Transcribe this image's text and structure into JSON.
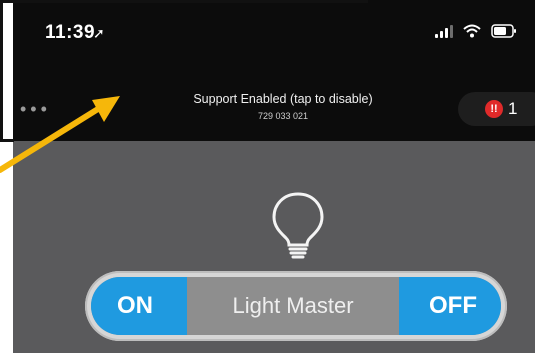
{
  "status_bar": {
    "time": "11:39",
    "location_icon": "location-arrow-icon",
    "signal_icon": "cellular-signal-icon",
    "wifi_icon": "wifi-icon",
    "battery_icon": "battery-icon"
  },
  "support_bar": {
    "menu_icon": "more-dots-icon",
    "message": "Support Enabled (tap to disable)",
    "support_id": "729 033 021",
    "alert_icon": "alert-icon",
    "alert_count": "1"
  },
  "device": {
    "icon": "light-bulb-icon",
    "name": "Light Master",
    "on_label": "ON",
    "off_label": "OFF"
  },
  "colors": {
    "accent": "#1f9ae0",
    "annotation_arrow": "#f6b70a",
    "alert": "#e02a2a"
  }
}
